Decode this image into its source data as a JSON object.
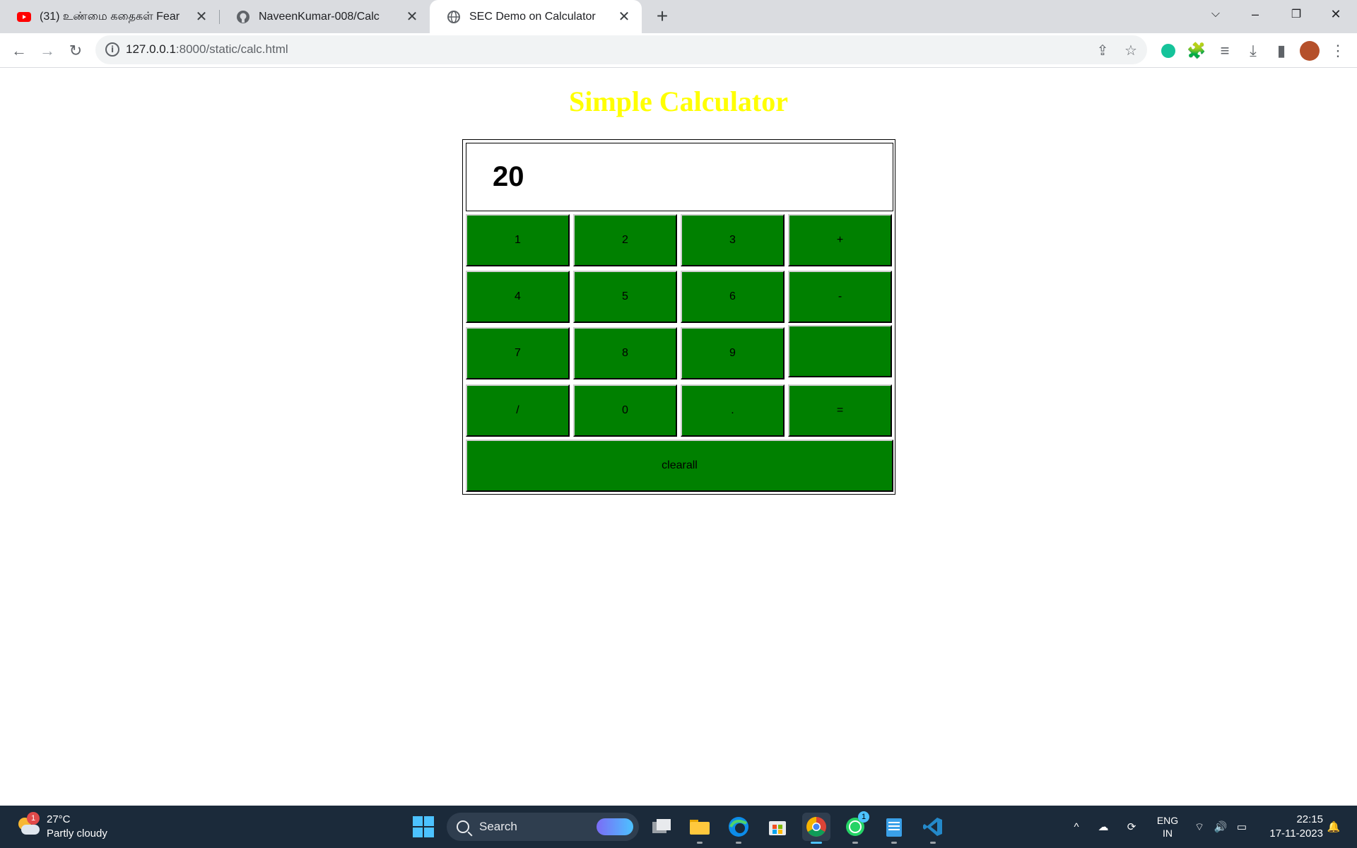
{
  "browser": {
    "tabs": [
      {
        "title": "(31) உண்மை கதைகள் Fear",
        "favicon": "youtube-icon"
      },
      {
        "title": "NaveenKumar-008/Calc",
        "favicon": "github-icon"
      },
      {
        "title": "SEC Demo on Calculator",
        "favicon": "globe-icon",
        "active": true
      }
    ],
    "url_host": "127.0.0.1",
    "url_rest": ":8000/static/calc.html"
  },
  "page": {
    "title": "Simple Calculator",
    "title_color": "#ffff00",
    "display_value": "20",
    "key_color": "#008000",
    "keys": [
      "1",
      "2",
      "3",
      "+",
      "4",
      "5",
      "6",
      "-",
      "7",
      "8",
      "9",
      "",
      "/",
      "0",
      ".",
      "="
    ],
    "clear_label": "clearall"
  },
  "taskbar": {
    "weather_temp": "27°C",
    "weather_desc": "Partly cloudy",
    "weather_badge": "1",
    "search_label": "Search",
    "whatsapp_badge": "1",
    "lang_top": "ENG",
    "lang_bottom": "IN",
    "time": "22:15",
    "date": "17-11-2023"
  }
}
